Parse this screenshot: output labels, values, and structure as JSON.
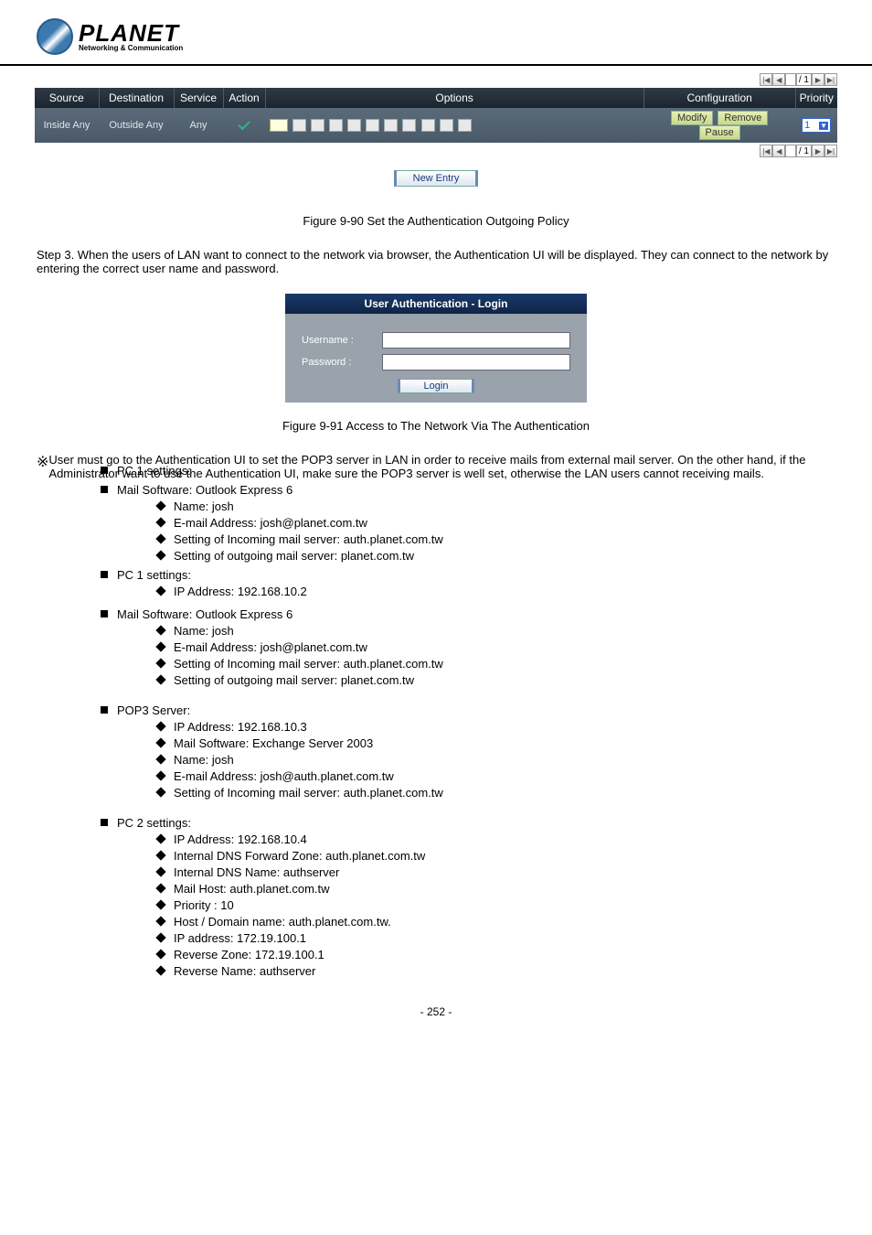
{
  "logo": {
    "name": "PLANET",
    "tagline": "Networking & Communication"
  },
  "pager": {
    "page_of": "/ 1"
  },
  "table": {
    "headers": [
      "Source",
      "Destination",
      "Service",
      "Action",
      "Options",
      "Configuration",
      "Priority"
    ],
    "row": {
      "source": "Inside Any",
      "destination": "Outside Any",
      "service": "Any",
      "modify": "Modify",
      "remove": "Remove",
      "pause": "Pause",
      "priority": "1"
    }
  },
  "new_entry": "New Entry",
  "fig1_caption": "Figure 9-90 Set the Authentication Outgoing Policy",
  "step3_text": "Step 3. When the users of LAN want to connect to the network via browser, the Authentication UI will be displayed. They can connect to the network by entering the correct user name and password.",
  "login": {
    "title": "User Authentication - Login",
    "username_label": "Username :",
    "password_label": "Password :",
    "button": "Login"
  },
  "fig2_caption": "Figure 9-91 Access to The Network Via The Authentication",
  "note": "User must go to the Authentication UI to set the POP3 server in LAN in order to receive mails from external mail server. On the other hand, if the Administrator want to use the Authentication UI, make sure the POP3 server is well set, otherwise the LAN users cannot receiving mails.",
  "pc1": {
    "title": "PC 1 settings:",
    "ip": "IP Address: 192.168.10.2",
    "mailsoft": "Mail Software: Outlook Express 6",
    "name": "Name: josh",
    "email": "E-mail Address: josh@planet.com.tw",
    "incoming": "Setting of Incoming mail server: auth.planet.com.tw",
    "outgoing": "Setting of outgoing mail server: planet.com.tw"
  },
  "server": {
    "title": "POP3 Server:",
    "ip": "IP Address: 192.168.10.3",
    "mailsoft": "Mail Software: Exchange Server 2003",
    "name": "Name: josh",
    "email": "E-mail Address: josh@auth.planet.com.tw",
    "incoming": "Setting of Incoming mail server: auth.planet.com.tw"
  },
  "pc2": {
    "title": "PC 2 settings:",
    "ip": "IP Address: 192.168.10.4",
    "zone": "Internal DNS Forward Zone: auth.planet.com.tw",
    "dnsname": "Internal DNS Name: authserver",
    "mailhost": "Mail Host: auth.planet.com.tw",
    "priority": "Priority : 10",
    "host": "Host / Domain name: auth.planet.com.tw.",
    "hostip": "IP address: 172.19.100.1",
    "rev": "Reverse Zone: 172.19.100.1",
    "revname": "Reverse Name: authserver"
  },
  "page_num": "- 252 -"
}
